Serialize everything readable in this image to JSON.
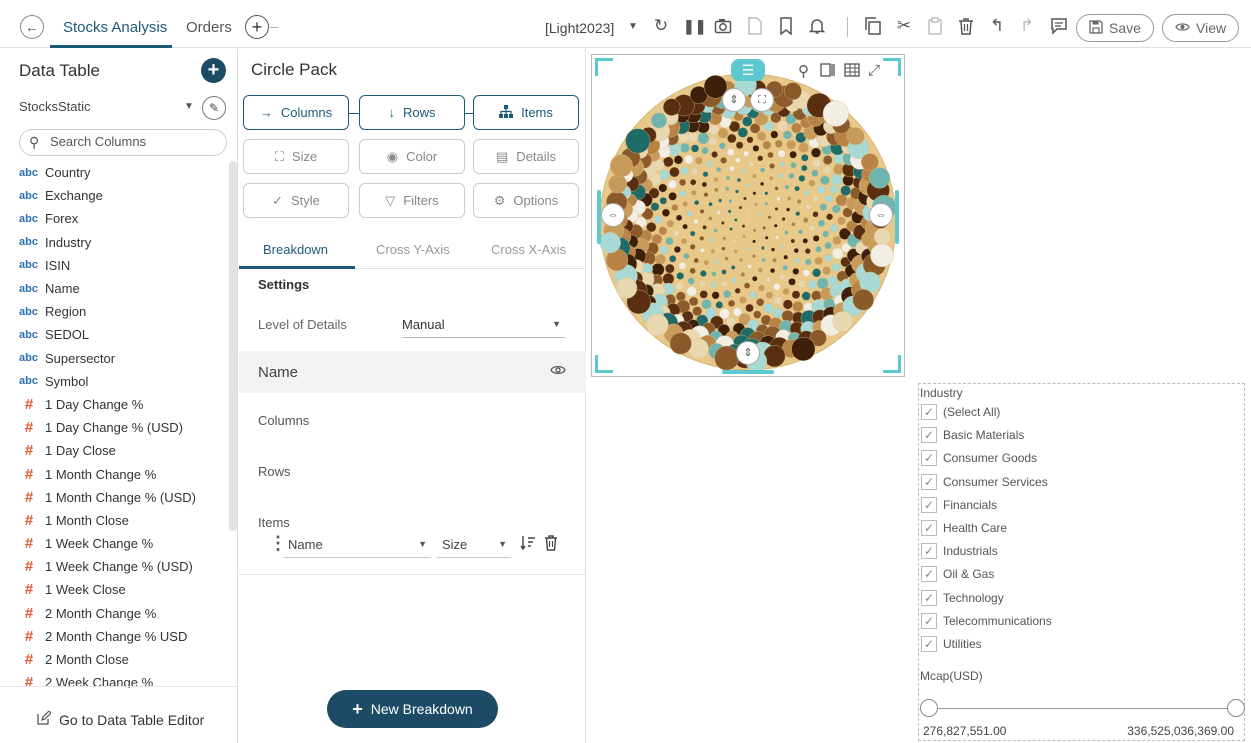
{
  "header": {
    "tabs": [
      {
        "label": "Stocks Analysis"
      },
      {
        "label": "Orders"
      }
    ],
    "theme": "[Light2023]",
    "save_label": "Save",
    "view_label": "View"
  },
  "data_table": {
    "title": "Data Table",
    "source": "StocksStatic",
    "search_placeholder": "Search Columns",
    "columns": [
      {
        "type": "abc",
        "name": "Country"
      },
      {
        "type": "abc",
        "name": "Exchange"
      },
      {
        "type": "abc",
        "name": "Forex"
      },
      {
        "type": "abc",
        "name": "Industry"
      },
      {
        "type": "abc",
        "name": "ISIN"
      },
      {
        "type": "abc",
        "name": "Name"
      },
      {
        "type": "abc",
        "name": "Region"
      },
      {
        "type": "abc",
        "name": "SEDOL"
      },
      {
        "type": "abc",
        "name": "Supersector"
      },
      {
        "type": "abc",
        "name": "Symbol"
      },
      {
        "type": "#",
        "name": "1 Day Change %"
      },
      {
        "type": "#",
        "name": "1 Day Change % (USD)"
      },
      {
        "type": "#",
        "name": "1 Day Close"
      },
      {
        "type": "#",
        "name": "1 Month Change %"
      },
      {
        "type": "#",
        "name": "1 Month Change % (USD)"
      },
      {
        "type": "#",
        "name": "1 Month Close"
      },
      {
        "type": "#",
        "name": "1 Week Change %"
      },
      {
        "type": "#",
        "name": "1 Week Change % (USD)"
      },
      {
        "type": "#",
        "name": "1 Week Close"
      },
      {
        "type": "#",
        "name": "2 Month Change %"
      },
      {
        "type": "#",
        "name": "2 Month Change % USD"
      },
      {
        "type": "#",
        "name": "2 Month Close"
      },
      {
        "type": "#",
        "name": "2 Week Change %"
      }
    ],
    "footer_link": "Go to Data Table Editor"
  },
  "settings_panel": {
    "title": "Circle Pack",
    "buttons": {
      "columns": "Columns",
      "rows": "Rows",
      "items": "Items",
      "size": "Size",
      "color": "Color",
      "details": "Details",
      "style": "Style",
      "filters": "Filters",
      "options": "Options"
    },
    "sub_tabs": {
      "breakdown": "Breakdown",
      "cross_y": "Cross Y-Axis",
      "cross_x": "Cross X-Axis"
    },
    "settings_label": "Settings",
    "level_of_details_label": "Level of Details",
    "level_of_details_value": "Manual",
    "breakdown_name": "Name",
    "columns_label": "Columns",
    "rows_label": "Rows",
    "items_label": "Items",
    "item_field": "Name",
    "item_sort": "Size",
    "new_breakdown_label": "New Breakdown"
  },
  "filter": {
    "industry_title": "Industry",
    "industries": [
      "(Select All)",
      "Basic Materials",
      "Consumer Goods",
      "Consumer Services",
      "Financials",
      "Health Care",
      "Industrials",
      "Oil & Gas",
      "Technology",
      "Telecommunications",
      "Utilities"
    ],
    "mcap_title": "Mcap(USD)",
    "mcap_min": "276,827,551.00",
    "mcap_max": "336,525,036,369.00"
  },
  "colors": {
    "accent": "#1d5a7a",
    "primary_button": "#1d4b66",
    "selection": "#5cc8cf",
    "circle_palette": [
      "#c89b5a",
      "#8a5a2b",
      "#5a2e10",
      "#6fb5ae",
      "#1f6b68",
      "#e9d7b0",
      "#f3eee4",
      "#a8d9d4",
      "#b88446",
      "#3d1f0a"
    ]
  }
}
